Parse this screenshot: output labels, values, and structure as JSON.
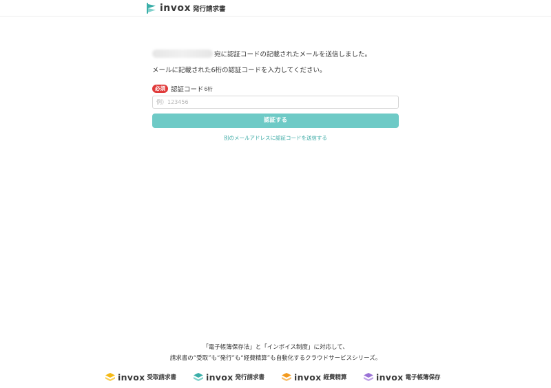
{
  "header": {
    "brand_word": "invox",
    "product_name": "発行請求書",
    "icon_color": "#3aaea8"
  },
  "main": {
    "message_sent_suffix": "宛に認証コードの記載されたメールを送信しました。",
    "message_instruction": "メールに記載された6桁の認証コードを入力してください。",
    "required_badge": "必須",
    "field_label": "認証コード",
    "field_sublabel": "6桁",
    "input_value": "",
    "input_placeholder": "例）123456",
    "submit_label": "認証する",
    "resend_link": "別のメールアドレスに認証コードを送信する"
  },
  "footer": {
    "line1": "「電子帳簿保存法」と「インボイス制度」に対応して、",
    "line2": "請求書の“受取”も“発行”も“経費精算”も自動化するクラウドサービスシリーズ。",
    "brands": [
      {
        "word": "invox",
        "name": "受取請求書",
        "color": "#f5b914",
        "icon": "stack-icon"
      },
      {
        "word": "invox",
        "name": "発行請求書",
        "color": "#3aaea8",
        "icon": "stack-icon"
      },
      {
        "word": "invox",
        "name": "経費精算",
        "color": "#f39a1e",
        "icon": "stack-icon"
      },
      {
        "word": "invox",
        "name": "電子帳簿保存",
        "color": "#9a72d6",
        "icon": "stack-icon"
      }
    ]
  },
  "colors": {
    "accent": "#6ecac6",
    "link": "#3aa9a4",
    "required": "#e03a3a"
  }
}
